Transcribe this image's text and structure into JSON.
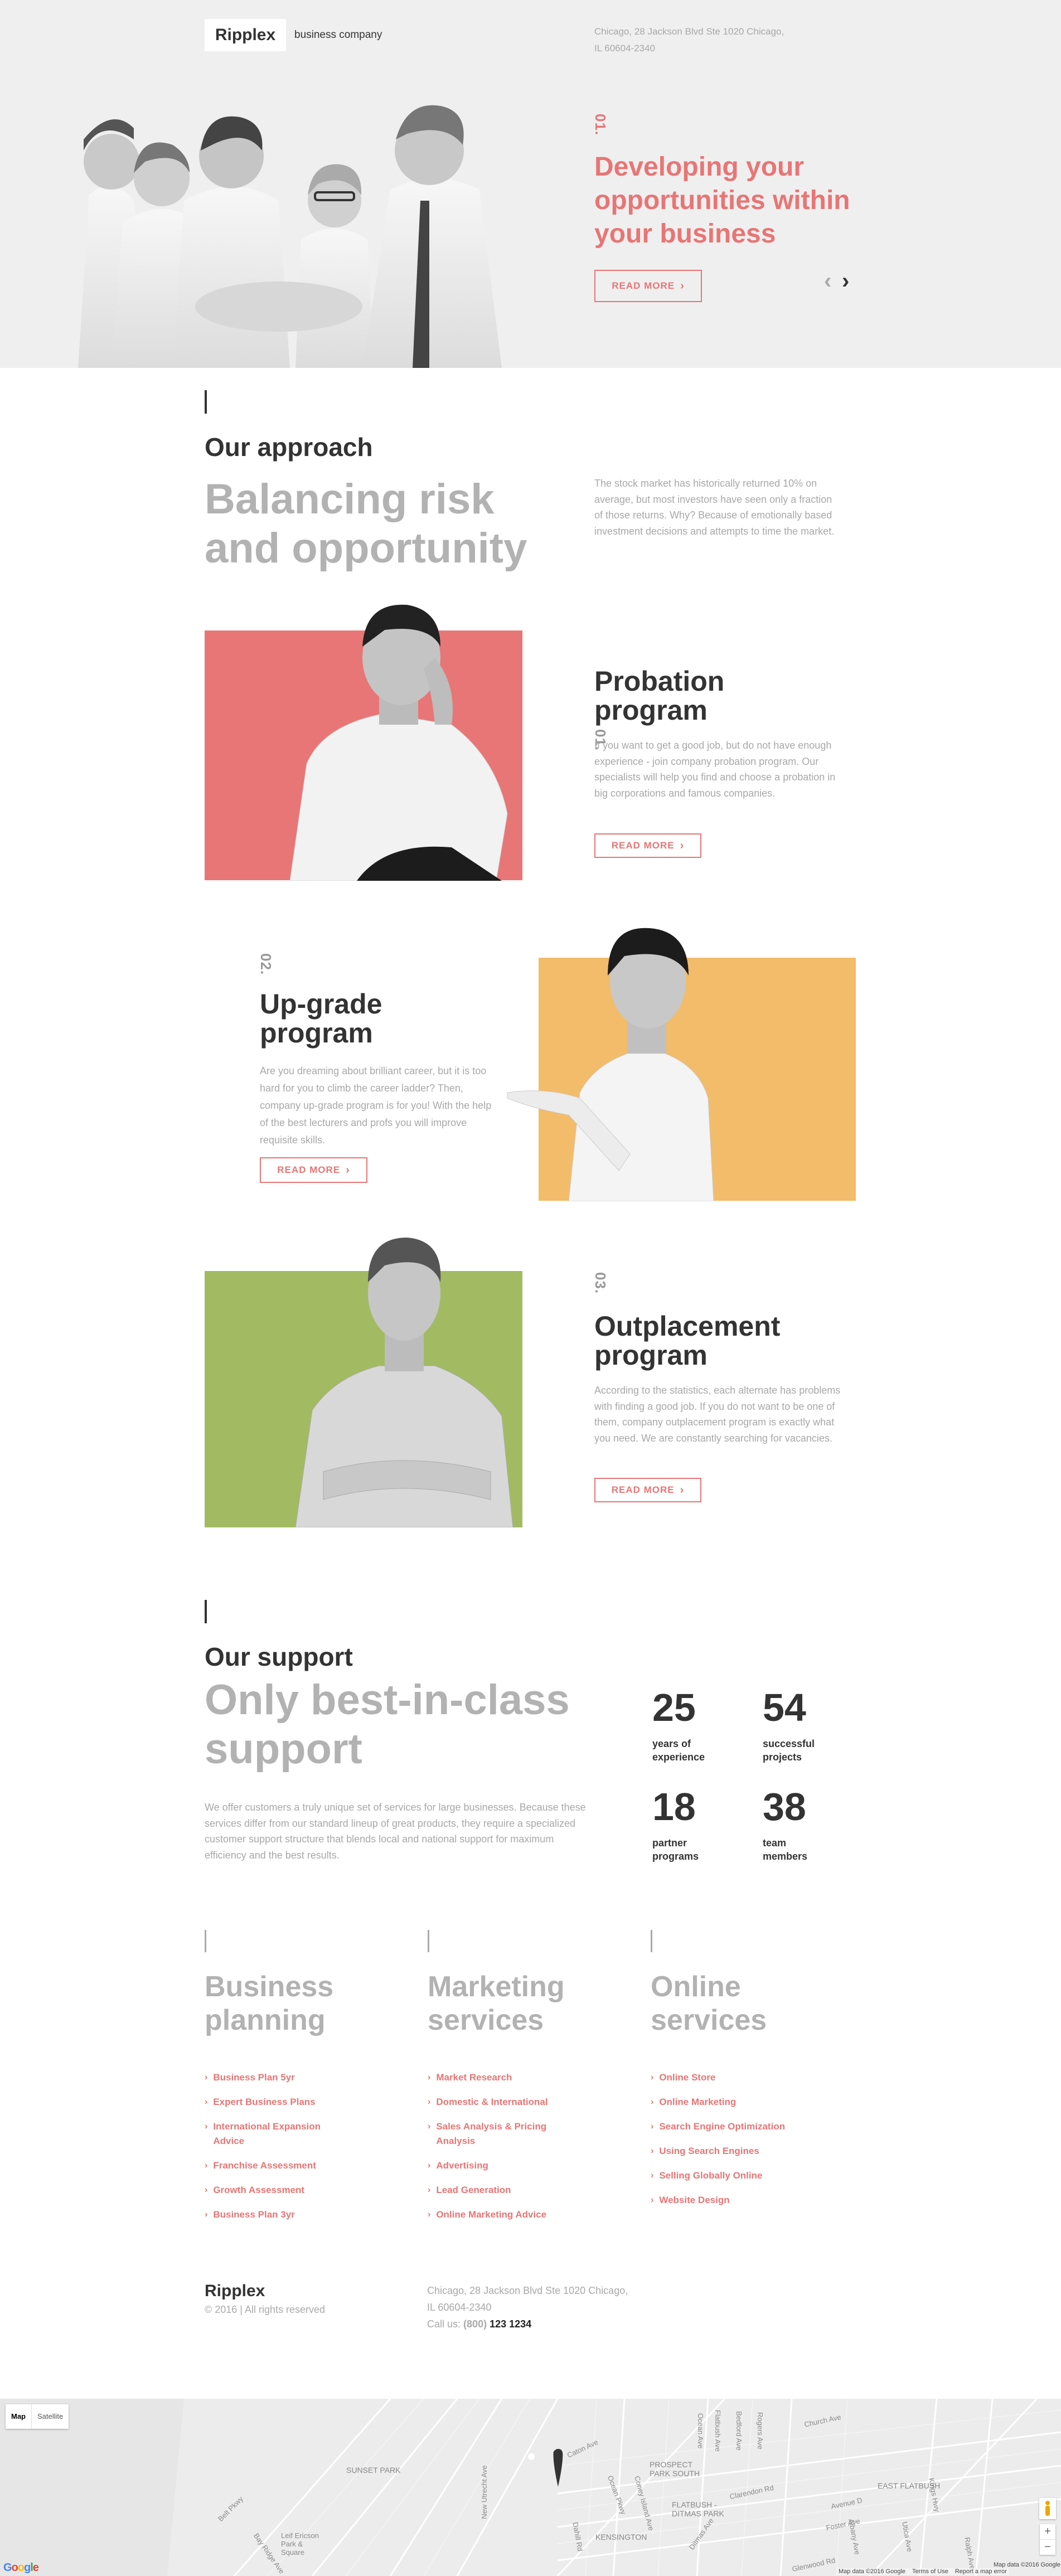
{
  "header": {
    "logo": "Ripplex",
    "tagline": "business company",
    "address_line1": "Chicago, 28 Jackson Blvd Ste 1020 Chicago,",
    "address_line2": "IL 60604-2340"
  },
  "hero": {
    "number": "01.",
    "title": "Developing your opportunities within your business",
    "button": "READ MORE",
    "prev_icon": "chevron-left-icon",
    "next_icon": "chevron-right-icon"
  },
  "approach": {
    "label": "Our approach",
    "heading_line1": "Balancing risk",
    "heading_line2": "and opportunity",
    "text": "The stock market has historically returned 10% on average, but most investors have seen only a fraction of those returns. Why? Because of emotionally based investment decisions and attempts to time the market.",
    "programs": [
      {
        "number": "01.",
        "title_line1": "Probation",
        "title_line2": "program",
        "text": "If you want to get a good job, but do not have enough experience - join company probation program. Our specialists will help you find and choose a probation in big corporations and famous companies.",
        "button": "READ MORE",
        "color": "#e87676"
      },
      {
        "number": "02.",
        "title_line1": "Up-grade",
        "title_line2": "program",
        "text": "Are you dreaming about brilliant career, but it is too hard for you to climb the career ladder? Then, company up-grade program is for you! With the help of the best lecturers and profs you will improve requisite skills.",
        "button": "READ MORE",
        "color": "#f2bc6a"
      },
      {
        "number": "03.",
        "title_line1": "Outplacement",
        "title_line2": "program",
        "text": "According to the statistics, each alternate has problems with finding a good job. If you do not want to be one of them, company outplacement program is exactly what you need. We are constantly searching for vacancies.",
        "button": "READ MORE",
        "color": "#a2bb62"
      }
    ]
  },
  "support": {
    "label": "Our support",
    "heading_line1": "Only best-in-class",
    "heading_line2": "support",
    "text": "We offer customers a truly unique set of services for large businesses. Because these services differ from our standard lineup of great products, they require a specialized customer support structure that blends local and national support for maximum efficiency and the best results.",
    "stats": [
      {
        "value": "25",
        "label_line1": "years of",
        "label_line2": "experience"
      },
      {
        "value": "54",
        "label_line1": "successful",
        "label_line2": "projects"
      },
      {
        "value": "18",
        "label_line1": "partner",
        "label_line2": "programs"
      },
      {
        "value": "38",
        "label_line1": "team",
        "label_line2": "members"
      }
    ]
  },
  "services": [
    {
      "title_line1": "Business",
      "title_line2": "planning",
      "items": [
        "Business Plan 5yr",
        "Expert Business Plans",
        "International Expansion Advice",
        "Franchise Assessment",
        "Growth Assessment",
        "Business Plan 3yr"
      ]
    },
    {
      "title_line1": "Marketing",
      "title_line2": "services",
      "items": [
        "Market Research",
        "Domestic & International",
        "Sales Analysis & Pricing Analysis",
        "Advertising",
        "Lead Generation",
        "Online Marketing Advice"
      ]
    },
    {
      "title_line1": "Online",
      "title_line2": "services",
      "items": [
        "Online Store",
        "Online Marketing",
        "Search Engine Optimization",
        "Using Search Engines",
        "Selling Globally Online",
        "Website Design"
      ]
    }
  ],
  "footer": {
    "logo": "Ripplex",
    "copyright": "© 2016 | All rights reserved",
    "address_line1": "Chicago, 28 Jackson Blvd Ste 1020 Chicago,",
    "address_line2": "IL 60604-2340",
    "call_label": "Call us:",
    "phone_code": "(800)",
    "phone_number": "123 1234"
  },
  "map": {
    "type_map": "Map",
    "type_satellite": "Satellite",
    "districts": [
      "SUNSET PARK",
      "PROSPECT PARK SOUTH",
      "EAST FLATBUSH",
      "FLATBUSH - DITMAS PARK",
      "KENSINGTON",
      "Leif Ericson Park & Square"
    ],
    "streets": [
      "Clarendon Rd",
      "Avenue D",
      "Foster Ave",
      "Church Ave",
      "Glenwood Rd",
      "Belt Pkwy",
      "Flatbush Ave",
      "Bedford Ave",
      "Rogers Ave",
      "Ocean Ave",
      "New Utrecht Ave",
      "Ocean Pkwy",
      "Coney Island Ave",
      "Dahill Rd",
      "Utica Ave",
      "Albany Ave",
      "Ralph Ave",
      "Kings Hwy",
      "Caton Ave",
      "Ditmas Ave",
      "Bay Ridge Ave"
    ],
    "google": "Google",
    "map_data": "Map data ©2016 Google",
    "terms": "Terms of Use",
    "report": "Report a map error",
    "map_data_2": "Map data ©2016 Google",
    "zoom_in": "+",
    "zoom_out": "−"
  }
}
